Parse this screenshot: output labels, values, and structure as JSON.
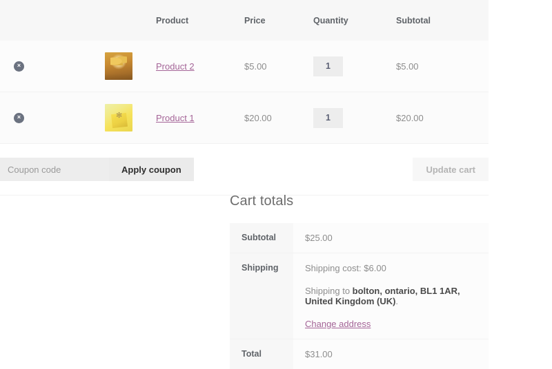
{
  "cart_table": {
    "headers": {
      "remove": "",
      "thumbnail": "",
      "product": "Product",
      "price": "Price",
      "quantity": "Quantity",
      "subtotal": "Subtotal"
    },
    "rows": [
      {
        "remove_label": "×",
        "remove_icon": "remove-circle-icon",
        "thumbnail_alt": "gift-box-gold-thumbnail",
        "name": "Product 2",
        "price": "$5.00",
        "quantity": "1",
        "subtotal": "$5.00"
      },
      {
        "remove_label": "×",
        "remove_icon": "remove-circle-icon",
        "thumbnail_alt": "gift-box-yellow-thumbnail",
        "name": "Product 1",
        "price": "$20.00",
        "quantity": "1",
        "subtotal": "$20.00"
      }
    ]
  },
  "actions": {
    "coupon_placeholder": "Coupon code",
    "coupon_value": "",
    "apply_coupon_label": "Apply coupon",
    "update_cart_label": "Update cart",
    "update_cart_disabled": true
  },
  "cart_totals": {
    "title": "Cart totals",
    "subtotal_label": "Subtotal",
    "subtotal_value": "$25.00",
    "shipping_label": "Shipping",
    "shipping_cost_line": "Shipping cost: $6.00",
    "shipping_to_prefix": "Shipping to ",
    "shipping_to_address": "bolton, ontario, BL1 1AR, United Kingdom (UK)",
    "shipping_to_suffix": ".",
    "change_address_label": "Change address",
    "total_label": "Total",
    "total_value": "$31.00"
  },
  "colors": {
    "link": "#a46497",
    "header_bg": "#f7f7f7",
    "text": "#8d8d8d",
    "label_text": "#5f6368",
    "button_bg": "#ebebeb",
    "input_bg": "#ededed",
    "remove_btn_bg": "#6b7280"
  }
}
